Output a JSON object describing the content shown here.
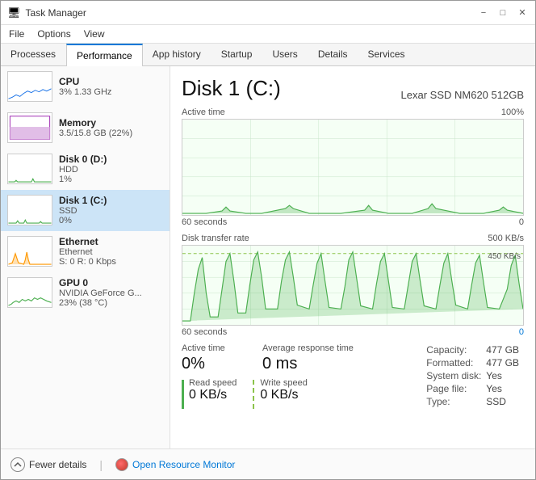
{
  "window": {
    "title": "Task Manager",
    "icon": "⚙"
  },
  "menu": {
    "items": [
      "File",
      "Options",
      "View"
    ]
  },
  "tabs": [
    {
      "id": "processes",
      "label": "Processes"
    },
    {
      "id": "performance",
      "label": "Performance",
      "active": true
    },
    {
      "id": "app-history",
      "label": "App history"
    },
    {
      "id": "startup",
      "label": "Startup"
    },
    {
      "id": "users",
      "label": "Users"
    },
    {
      "id": "details",
      "label": "Details"
    },
    {
      "id": "services",
      "label": "Services"
    }
  ],
  "sidebar": {
    "items": [
      {
        "id": "cpu",
        "name": "CPU",
        "sub1": "3% 1.33 GHz",
        "sub2": "",
        "active": false
      },
      {
        "id": "memory",
        "name": "Memory",
        "sub1": "3.5/15.8 GB (22%)",
        "sub2": "",
        "active": false
      },
      {
        "id": "disk0",
        "name": "Disk 0 (D:)",
        "sub1": "HDD",
        "sub2": "1%",
        "active": false
      },
      {
        "id": "disk1",
        "name": "Disk 1 (C:)",
        "sub1": "SSD",
        "sub2": "0%",
        "active": true
      },
      {
        "id": "ethernet",
        "name": "Ethernet",
        "sub1": "Ethernet",
        "sub2": "S: 0 R: 0 Kbps",
        "active": false
      },
      {
        "id": "gpu0",
        "name": "GPU 0",
        "sub1": "NVIDIA GeForce G...",
        "sub2": "23% (38 °C)",
        "active": false
      }
    ]
  },
  "main": {
    "disk_title": "Disk 1 (C:)",
    "disk_model": "Lexar SSD NM620 512GB",
    "chart1": {
      "label": "Active time",
      "max": "100%",
      "x_min": "60 seconds",
      "x_max": "0"
    },
    "chart2": {
      "label": "Disk transfer rate",
      "max": "500 KB/s",
      "secondary_label": "450 KB/s",
      "x_min": "60 seconds",
      "x_max": "0"
    },
    "active_time_label": "Active time",
    "active_time_value": "0%",
    "avg_response_label": "Average response time",
    "avg_response_value": "0 ms",
    "read_speed_label": "Read speed",
    "read_speed_value": "0 KB/s",
    "write_speed_label": "Write speed",
    "write_speed_value": "0 KB/s",
    "right_stats": {
      "capacity_label": "Capacity:",
      "capacity_value": "477 GB",
      "formatted_label": "Formatted:",
      "formatted_value": "477 GB",
      "system_disk_label": "System disk:",
      "system_disk_value": "Yes",
      "page_file_label": "Page file:",
      "page_file_value": "Yes",
      "type_label": "Type:",
      "type_value": "SSD"
    }
  },
  "bottom": {
    "fewer_details": "Fewer details",
    "open_resource_monitor": "Open Resource Monitor"
  }
}
